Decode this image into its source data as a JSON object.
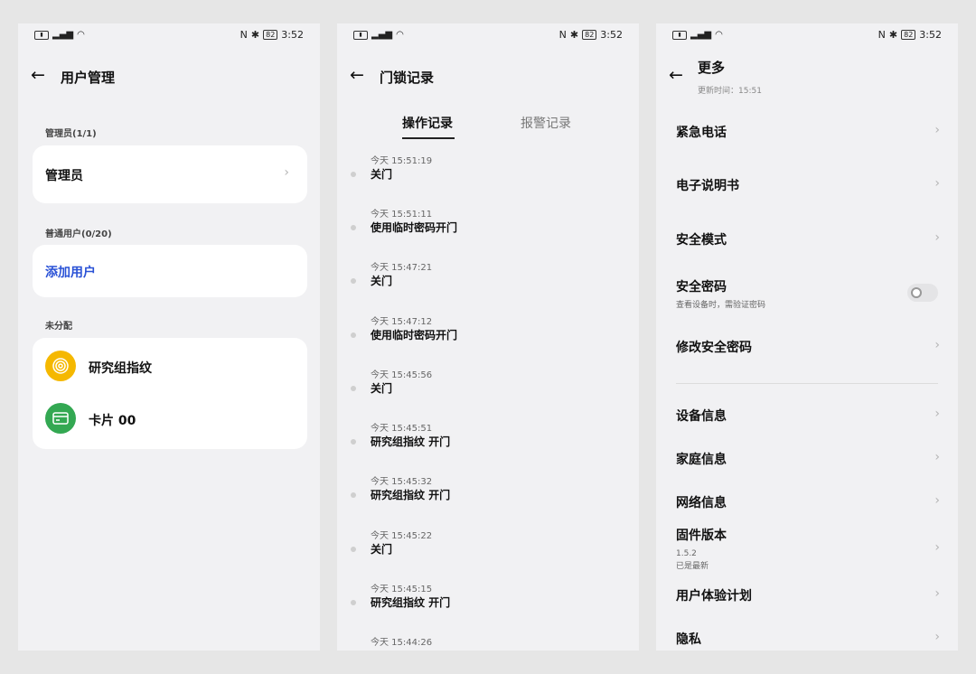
{
  "status": {
    "time": "3:52",
    "left_icons": "信号 WiFi",
    "battery": "82"
  },
  "screen1": {
    "title": "用户管理",
    "admin_section": "管理员(1/1)",
    "admin_item": "管理员",
    "normal_section": "普通用户(0/20)",
    "add_user": "添加用户",
    "unassigned_section": "未分配",
    "unassigned_items": [
      {
        "label": "研究组指纹",
        "icon": "fingerprint-icon",
        "color": "#f5b800"
      },
      {
        "label": "卡片 00",
        "icon": "card-icon",
        "color": "#33a852"
      }
    ]
  },
  "screen2": {
    "title": "门锁记录",
    "tabs": [
      "操作记录",
      "报警记录"
    ],
    "logs": [
      {
        "time": "今天 15:51:19",
        "action": "关门"
      },
      {
        "time": "今天 15:51:11",
        "action": "使用临时密码开门"
      },
      {
        "time": "今天 15:47:21",
        "action": "关门"
      },
      {
        "time": "今天 15:47:12",
        "action": "使用临时密码开门"
      },
      {
        "time": "今天 15:45:56",
        "action": "关门"
      },
      {
        "time": "今天 15:45:51",
        "action": "研究组指纹 开门"
      },
      {
        "time": "今天 15:45:32",
        "action": "研究组指纹 开门"
      },
      {
        "time": "今天 15:45:22",
        "action": "关门"
      },
      {
        "time": "今天 15:45:15",
        "action": "研究组指纹 开门"
      },
      {
        "time": "今天 15:44:26",
        "action": ""
      }
    ]
  },
  "screen3": {
    "title": "更多",
    "subtitle": "更新时间：15:51",
    "items": [
      {
        "label": "紧急电话"
      },
      {
        "label": "电子说明书"
      },
      {
        "label": "安全模式"
      },
      {
        "label": "安全密码",
        "sub": "查看设备时，需验证密码",
        "toggle": false
      },
      {
        "label": "修改安全密码"
      },
      {
        "label": "设备信息"
      },
      {
        "label": "家庭信息"
      },
      {
        "label": "网络信息"
      },
      {
        "label": "固件版本",
        "sub": "1.5.2",
        "sub2": "已是最新"
      },
      {
        "label": "用户体验计划"
      },
      {
        "label": "隐私"
      }
    ]
  }
}
